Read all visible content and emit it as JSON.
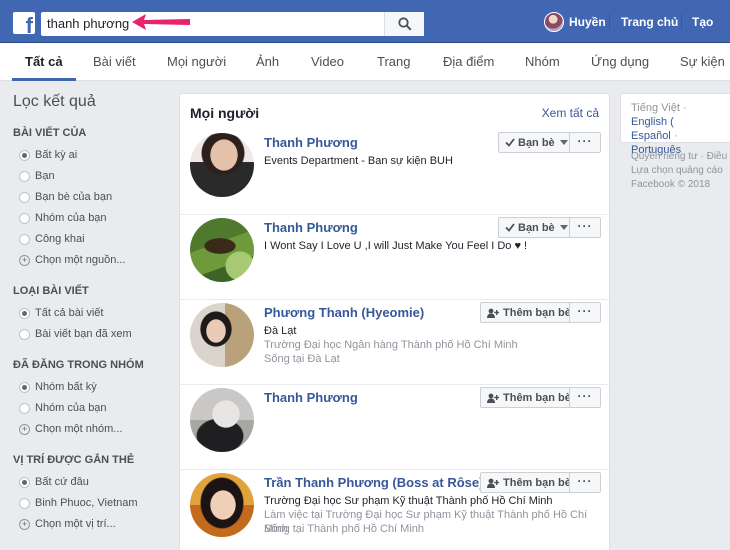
{
  "header": {
    "logo_letter": "f",
    "search_value": "thanh phương",
    "user_name": "Huyền",
    "home_label": "Trang chủ",
    "create_label": "Tạo"
  },
  "tabs": [
    "Tất cả",
    "Bài viết",
    "Mọi người",
    "Ảnh",
    "Video",
    "Trang",
    "Địa điểm",
    "Nhóm",
    "Ứng dụng",
    "Sự kiện"
  ],
  "active_tab": "Tất cả",
  "filters": {
    "title": "Lọc kết quả",
    "groups": [
      {
        "title": "BÀI VIẾT CỦA",
        "items": [
          "Bất kỳ ai",
          "Bạn",
          "Bạn bè của bạn",
          "Nhóm của bạn",
          "Công khai"
        ],
        "selected": 0,
        "more": "Chọn một nguồn..."
      },
      {
        "title": "LOẠI BÀI VIẾT",
        "items": [
          "Tất cả bài viết",
          "Bài viết bạn đã xem"
        ],
        "selected": 0
      },
      {
        "title": "ĐÃ ĐĂNG TRONG NHÓM",
        "items": [
          "Nhóm bất kỳ",
          "Nhóm của bạn"
        ],
        "selected": 0,
        "more": "Chọn một nhóm..."
      },
      {
        "title": "VỊ TRÍ ĐƯỢC GẮN THẺ",
        "items": [
          "Bất cứ đâu",
          "Binh Phuoc, Vietnam"
        ],
        "selected": 0,
        "more": "Chọn một vị trí..."
      }
    ]
  },
  "people": {
    "title": "Mọi người",
    "see_all": "Xem tất cả",
    "friend_label": "Bạn bè",
    "add_friend_label": "Thêm bạn bè",
    "more_label": "···",
    "results": [
      {
        "name": "Thanh Phương",
        "lines": [
          "Events Department - Ban sự kiện BUH"
        ],
        "is_friend": true
      },
      {
        "name": "Thanh Phương",
        "lines": [
          "I Wont Say I Love U ,I will Just Make You Feel I Do ♥ !"
        ],
        "is_friend": true
      },
      {
        "name": "Phương Thanh (Hyeomie)",
        "lines": [
          "Đà Lạt",
          "Trường Đại học Ngân hàng Thành phố Hồ Chí Minh",
          "Sống tại Đà Lạt"
        ],
        "is_friend": false
      },
      {
        "name": "Thanh Phương",
        "lines": [],
        "is_friend": false
      },
      {
        "name": "Trần Thanh Phương (Boss at Rôse)",
        "lines": [
          "Trường Đại học Sư phạm Kỹ thuật Thành phố Hồ Chí Minh",
          "Làm việc tại Trường Đại học Sư phạm Kỹ thuật Thành phố Hồ Chí Minh",
          "Sống tại Thành phố Hồ Chí Minh"
        ],
        "is_friend": false
      }
    ]
  },
  "languages": {
    "current": "Tiếng Việt",
    "sep": " · ",
    "links": [
      "English (",
      "Español",
      "Português"
    ]
  },
  "footer": {
    "line1": "Quyền riêng tư · Điều",
    "line2": "Lựa chọn quảng cáo",
    "line3": "Facebook © 2018"
  },
  "colors": {
    "brand": "#4267b2",
    "link": "#365899",
    "arrow": "#e8236b"
  }
}
